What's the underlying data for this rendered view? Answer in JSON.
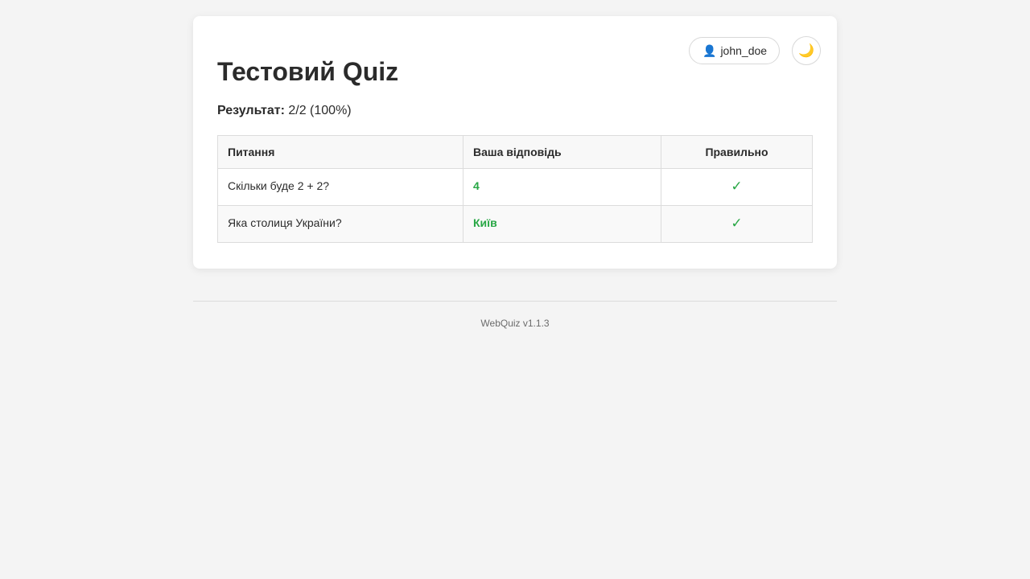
{
  "header": {
    "username": "john_doe",
    "user_icon": "👤",
    "user_icon_name": "user-icon",
    "theme_icon": "🌙",
    "theme_icon_name": "moon-icon"
  },
  "quiz": {
    "title": "Тестовий Quiz",
    "result_label": "Результат:",
    "result_value": " 2/2 (100%)"
  },
  "table": {
    "headers": {
      "question": "Питання",
      "answer": "Ваша відповідь",
      "correct": "Правильно"
    },
    "rows": [
      {
        "question": "Скільки буде 2 + 2?",
        "answer": "4",
        "correct": "✓"
      },
      {
        "question": "Яка столиця України?",
        "answer": "Київ",
        "correct": "✓"
      }
    ]
  },
  "footer": {
    "version": "WebQuiz v1.1.3"
  },
  "colors": {
    "correct": "#28a745",
    "background": "#f4f4f4",
    "card": "#ffffff"
  }
}
